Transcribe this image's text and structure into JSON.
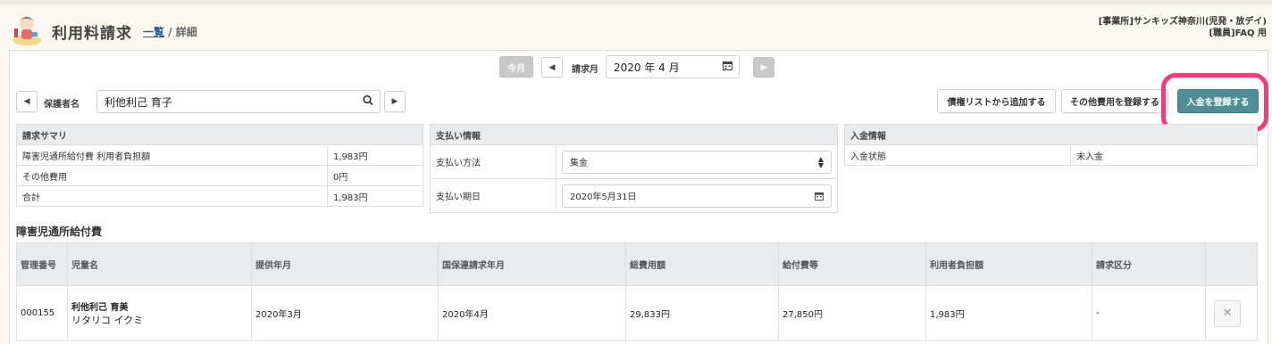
{
  "header": {
    "title": "利用料請求",
    "breadcrumb_link": "一覧",
    "breadcrumb_sep": "/",
    "breadcrumb_current": "詳細",
    "office_line1": "[事業所]サンキッズ神奈川(児発・放デイ)",
    "office_line2": "[職員]FAQ 用"
  },
  "month_nav": {
    "today_label": "今月",
    "month_label": "請求月",
    "month_value": "2020 年 4 月"
  },
  "guardian": {
    "label": "保護者名",
    "value": "利他利己 育子"
  },
  "actions": {
    "add_from_list": "債権リストから追加する",
    "register_other": "その他費用を登録する",
    "register_payment": "入金を登録する"
  },
  "summary": {
    "title": "請求サマリ",
    "rows": [
      {
        "label": "障害児通所給付費 利用者負担額",
        "value": "1,983円"
      },
      {
        "label": "その他費用",
        "value": "0円"
      },
      {
        "label": "合計",
        "value": "1,983円"
      }
    ]
  },
  "payment_info": {
    "title": "支払い情報",
    "method_label": "支払い方法",
    "method_value": "集金",
    "due_label": "支払い期日",
    "due_value": "2020年5月31日"
  },
  "deposit_info": {
    "title": "入金情報",
    "status_label": "入金状態",
    "status_value": "未入金"
  },
  "section": {
    "title": "障害児通所給付費"
  },
  "table": {
    "headers": [
      "管理番号",
      "児童名",
      "提供年月",
      "国保連請求年月",
      "総費用額",
      "給付費等",
      "利用者負担額",
      "請求区分",
      ""
    ],
    "rows": [
      {
        "id": "000155",
        "name": "利他利己 育美",
        "kana": "リタリコ イクミ",
        "service_month": "2020年3月",
        "claim_month": "2020年4月",
        "total": "29,833円",
        "benefit": "27,850円",
        "user_burden": "1,983円",
        "category": "-"
      }
    ]
  },
  "colors": {
    "accent_teal": "#4f8e96",
    "highlight_pink": "#ef3d7a",
    "header_bg": "#e8ecef",
    "link_blue": "#1f5fa0"
  }
}
